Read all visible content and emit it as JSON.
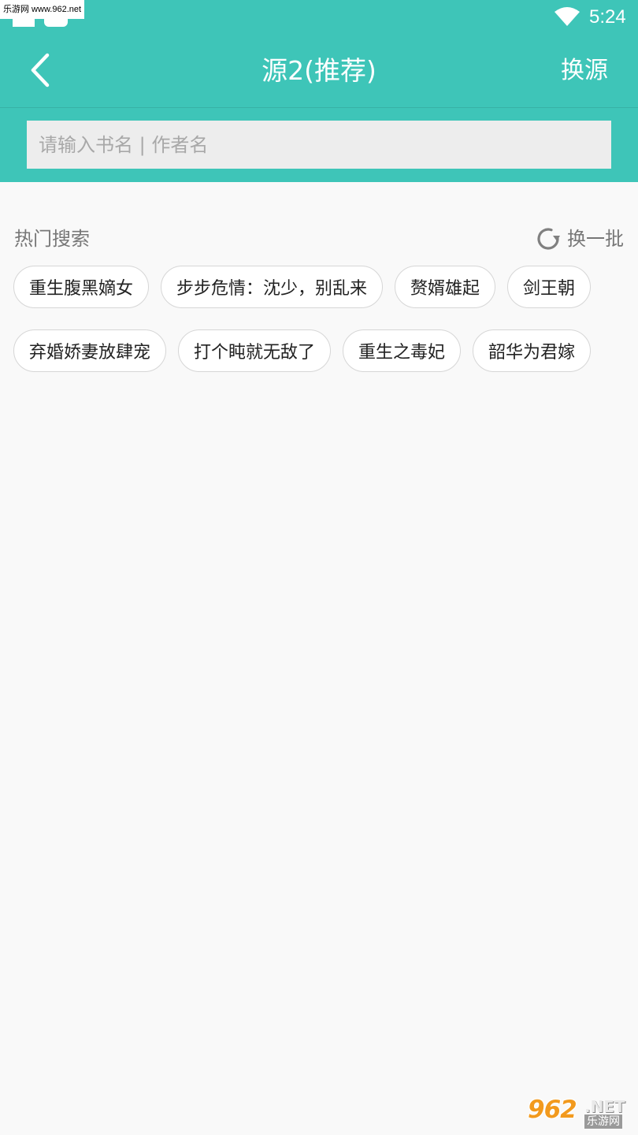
{
  "status_bar": {
    "watermark": "乐游网 www.962.net",
    "time": "5:24"
  },
  "appbar": {
    "title": "源2(推荐)",
    "switch_source_label": "换源"
  },
  "search": {
    "placeholder": "请输入书名 | 作者名",
    "value": ""
  },
  "hot_search": {
    "title": "热门搜索",
    "refresh_label": "换一批",
    "tags": [
      "重生腹黑嫡女",
      "步步危情：沈少，别乱来",
      "赘婿雄起",
      "剑王朝",
      "弃婚娇妻放肆宠",
      "打个盹就无敌了",
      "重生之毒妃",
      "韶华为君嫁"
    ]
  },
  "watermark_bottom": {
    "number": "962",
    "net": ".NET",
    "site": "乐游网"
  },
  "colors": {
    "header": "#3ec5b8",
    "background": "#f9f9f9",
    "accent_watermark": "#f29a1e"
  }
}
